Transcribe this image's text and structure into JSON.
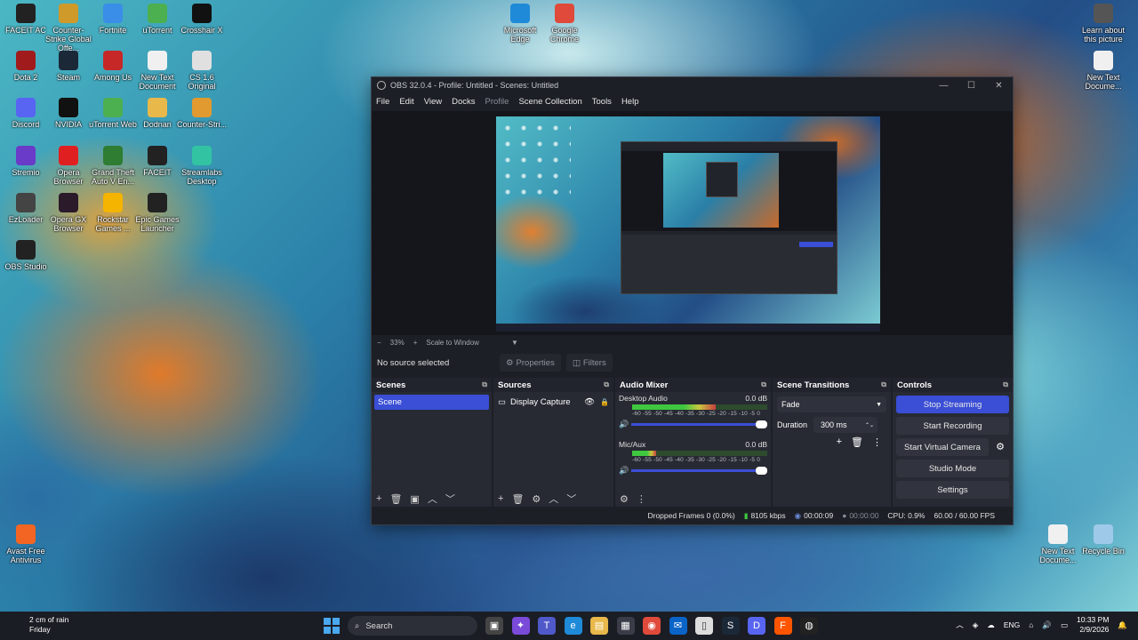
{
  "desktop": {
    "icons_left": [
      {
        "label": "FACEIT AC",
        "icon": "faceit-icon",
        "color": "#222222"
      },
      {
        "label": "Counter-Strike Global Offe...",
        "icon": "csgo-icon",
        "color": "#d09a2a"
      },
      {
        "label": "Fortnite",
        "icon": "fortnite-icon",
        "color": "#3a8ee8"
      },
      {
        "label": "uTorrent",
        "icon": "utorrent-icon",
        "color": "#4caf50"
      },
      {
        "label": "Crosshair X",
        "icon": "crosshair-icon",
        "color": "#111111"
      },
      {
        "label": "Dota 2",
        "icon": "dota-icon",
        "color": "#a01c1c"
      },
      {
        "label": "Steam",
        "icon": "steam-icon",
        "color": "#1b2838"
      },
      {
        "label": "Among Us",
        "icon": "among-us-icon",
        "color": "#c62828"
      },
      {
        "label": "New Text Document",
        "icon": "text-file-icon",
        "color": "#f0f0f0"
      },
      {
        "label": "CS 1.6 Original",
        "icon": "cs16-icon",
        "color": "#e0e0e0"
      },
      {
        "label": "Discord",
        "icon": "discord-icon",
        "color": "#5865f2"
      },
      {
        "label": "NVIDIA",
        "icon": "nvidia-icon",
        "color": "#111111"
      },
      {
        "label": "uTorrent Web",
        "icon": "utorrent-web-icon",
        "color": "#4caf50"
      },
      {
        "label": "Dodnan",
        "icon": "folder-icon",
        "color": "#e8b84a"
      },
      {
        "label": "Counter-Stri...",
        "icon": "counter-strike-icon",
        "color": "#e09a30"
      },
      {
        "label": "Stremio",
        "icon": "stremio-icon",
        "color": "#6a3ac8"
      },
      {
        "label": "Opera Browser",
        "icon": "opera-icon",
        "color": "#e02020"
      },
      {
        "label": "Grand Theft Auto V En...",
        "icon": "gta-icon",
        "color": "#2e7d32"
      },
      {
        "label": "FACEIT",
        "icon": "faceit-app-icon",
        "color": "#222222"
      },
      {
        "label": "Streamlabs Desktop",
        "icon": "streamlabs-icon",
        "color": "#31c3a2"
      },
      {
        "label": "EzLoader",
        "icon": "ezloader-icon",
        "color": "#444444"
      },
      {
        "label": "Opera GX Browser",
        "icon": "opera-gx-icon",
        "color": "#2a1a2a"
      },
      {
        "label": "Rockstar Games ...",
        "icon": "rockstar-icon",
        "color": "#f4b400"
      },
      {
        "label": "Epic Games Launcher",
        "icon": "epic-icon",
        "color": "#222222"
      },
      {
        "label": "OBS Studio",
        "icon": "obs-icon",
        "color": "#222222"
      },
      {
        "label": "Avast Free Antivirus",
        "icon": "avast-icon",
        "color": "#f26522"
      }
    ],
    "icons_top": [
      {
        "label": "Microsoft Edge",
        "icon": "edge-icon",
        "color": "#1f8ad8"
      },
      {
        "label": "Google Chrome",
        "icon": "chrome-icon",
        "color": "#e04a3a"
      }
    ],
    "icons_right": [
      {
        "label": "Learn about this picture",
        "icon": "camera-icon",
        "color": "#555555"
      },
      {
        "label": "New Text Docume...",
        "icon": "text-file-icon",
        "color": "#f0f0f0"
      },
      {
        "label": "New Text Docume...",
        "icon": "text-file-icon",
        "color": "#f0f0f0"
      },
      {
        "label": "Recycle Bin",
        "icon": "recycle-bin-icon",
        "color": "#9ec9e8"
      }
    ]
  },
  "obs": {
    "title": "OBS 32.0.4 - Profile: Untitled - Scenes: Untitled",
    "window_buttons": [
      "—",
      "☐",
      "✕"
    ],
    "menu": [
      "File",
      "Edit",
      "View",
      "Docks",
      "Profile",
      "Scene Collection",
      "Tools",
      "Help"
    ],
    "zoom": {
      "minus": "−",
      "percent": "33%",
      "plus": "+",
      "scale": "Scale to Window",
      "arrow": "▼"
    },
    "source_bar": {
      "label": "No source selected",
      "properties": "Properties",
      "filters": "Filters"
    },
    "scenes": {
      "title": "Scenes",
      "items": [
        "Scene"
      ],
      "footer": [
        "+",
        "🗑",
        "▣",
        "︿",
        "﹀"
      ]
    },
    "sources": {
      "title": "Sources",
      "items": [
        {
          "name": "Display Capture"
        }
      ],
      "footer": [
        "+",
        "🗑",
        "⚙",
        "︿",
        "﹀"
      ]
    },
    "mixer": {
      "title": "Audio Mixer",
      "channels": [
        {
          "name": "Desktop Audio",
          "db": "0.0 dB",
          "level": 0.62
        },
        {
          "name": "Mic/Aux",
          "db": "0.0 dB",
          "level": 0.18
        }
      ],
      "ticks": "-60 -55 -50 -45 -40 -35 -30 -25 -20 -15 -10 -5 0",
      "footer": [
        "⚙",
        "⋮"
      ]
    },
    "transitions": {
      "title": "Scene Transitions",
      "selected": "Fade",
      "duration_label": "Duration",
      "duration_value": "300 ms",
      "tools": [
        "+",
        "🗑",
        "⋮"
      ]
    },
    "controls": {
      "title": "Controls",
      "stop_streaming": "Stop Streaming",
      "start_recording": "Start Recording",
      "start_virtual_camera": "Start Virtual Camera",
      "studio_mode": "Studio Mode",
      "settings": "Settings"
    },
    "status": {
      "dropped": "Dropped Frames 0 (0.0%)",
      "bitrate": "8105 kbps",
      "stream_time": "00:00:09",
      "rec_time": "00:00:00",
      "cpu": "CPU: 0.9%",
      "fps": "60.00 / 60.00 FPS"
    }
  },
  "taskbar": {
    "weather_line1": "2 cm of rain",
    "weather_line2": "Friday",
    "search": "Search",
    "language": "ENG",
    "time": "10:33 PM",
    "date": "2/9/2026"
  },
  "colors": {
    "accent": "#3a4ed6",
    "panel": "#272a33",
    "window": "#1d1f26"
  }
}
